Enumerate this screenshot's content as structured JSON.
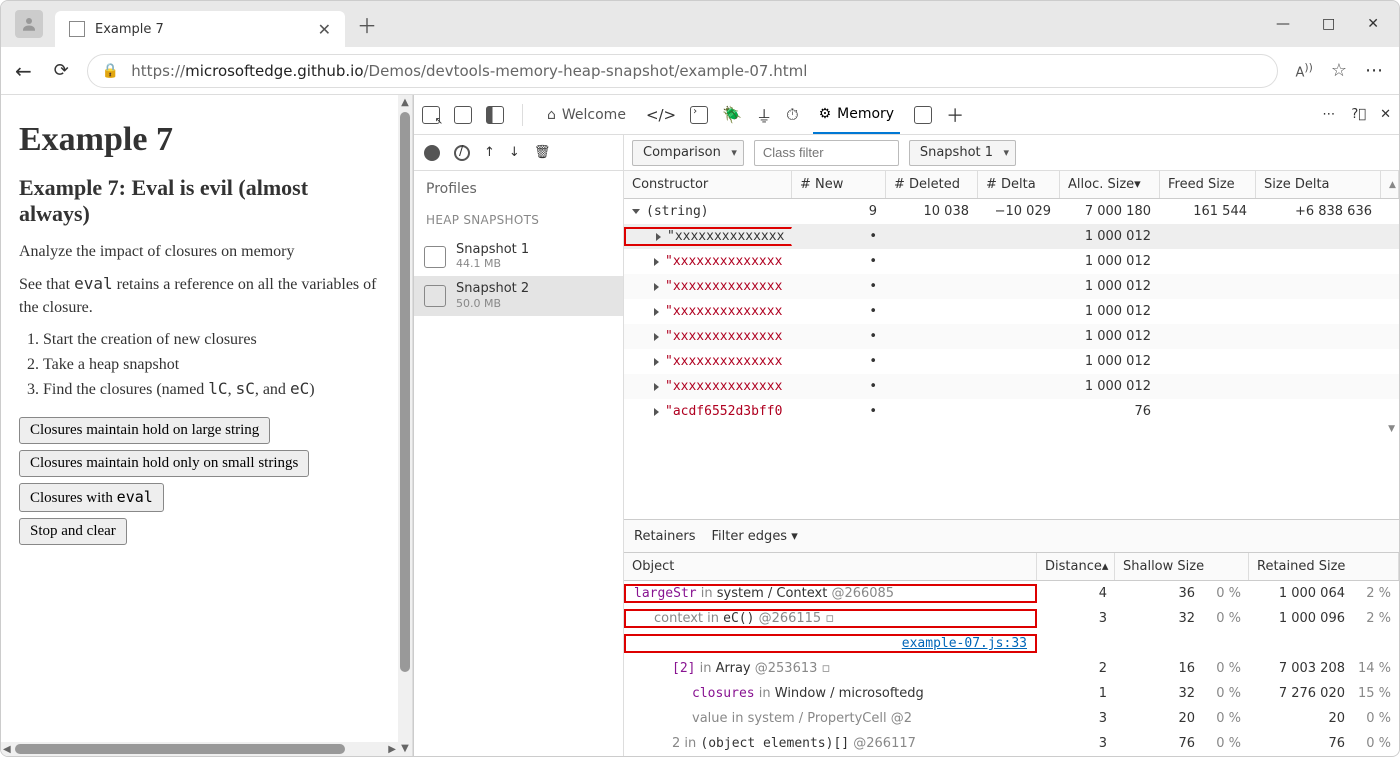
{
  "browser": {
    "tab_title": "Example 7",
    "url_prefix": "https://",
    "url_domain": "microsoftedge.github.io",
    "url_path": "/Demos/devtools-memory-heap-snapshot/example-07.html"
  },
  "page": {
    "h1": "Example 7",
    "h2": "Example 7: Eval is evil (almost always)",
    "p1": "Analyze the impact of closures on memory",
    "p2_pre": "See that ",
    "p2_code": "eval",
    "p2_post": " retains a reference on all the variables of the closure.",
    "steps": [
      "Start the creation of new closures",
      "Take a heap snapshot",
      "Find the closures (named lC, sC, and eC)"
    ],
    "btn1": "Closures maintain hold on large string",
    "btn2": "Closures maintain hold only on small strings",
    "btn3_pre": "Closures with ",
    "btn3_code": "eval",
    "btn4": "Stop and clear"
  },
  "devtools": {
    "tabs": {
      "welcome": "Welcome",
      "memory": "Memory"
    },
    "profiles": {
      "title": "Profiles",
      "section": "HEAP SNAPSHOTS",
      "snapshots": [
        {
          "name": "Snapshot 1",
          "size": "44.1 MB"
        },
        {
          "name": "Snapshot 2",
          "size": "50.0 MB"
        }
      ]
    },
    "toolbar": {
      "mode": "Comparison",
      "filter_placeholder": "Class filter",
      "base": "Snapshot 1"
    },
    "grid": {
      "headers": {
        "constructor": "Constructor",
        "new": "# New",
        "deleted": "# Deleted",
        "delta": "# Delta",
        "alloc": "Alloc. Size",
        "freed": "Freed Size",
        "size_delta": "Size Delta"
      },
      "rows": [
        {
          "expanded": true,
          "label": "(string)",
          "new": "9",
          "deleted": "10 038",
          "delta": "−10 029",
          "alloc": "7 000 180",
          "freed": "161 544",
          "size_delta": "+6 838 636"
        },
        {
          "indent": 1,
          "label": "\"xxxxxxxxxxxxxx",
          "dot": true,
          "alloc": "1 000 012",
          "highlight": true,
          "selected": true
        },
        {
          "indent": 1,
          "red": true,
          "label": "\"xxxxxxxxxxxxxx",
          "dot": true,
          "alloc": "1 000 012"
        },
        {
          "indent": 1,
          "red": true,
          "label": "\"xxxxxxxxxxxxxx",
          "dot": true,
          "alloc": "1 000 012"
        },
        {
          "indent": 1,
          "red": true,
          "label": "\"xxxxxxxxxxxxxx",
          "dot": true,
          "alloc": "1 000 012"
        },
        {
          "indent": 1,
          "red": true,
          "label": "\"xxxxxxxxxxxxxx",
          "dot": true,
          "alloc": "1 000 012"
        },
        {
          "indent": 1,
          "red": true,
          "label": "\"xxxxxxxxxxxxxx",
          "dot": true,
          "alloc": "1 000 012"
        },
        {
          "indent": 1,
          "red": true,
          "label": "\"xxxxxxxxxxxxxx",
          "dot": true,
          "alloc": "1 000 012"
        },
        {
          "indent": 1,
          "red": true,
          "label": "\"acdf6552d3bff0",
          "dot": true,
          "alloc": "76"
        }
      ]
    },
    "retainers": {
      "title": "Retainers",
      "filter": "Filter edges",
      "headers": {
        "object": "Object",
        "distance": "Distance",
        "shallow": "Shallow Size",
        "retained": "Retained Size"
      },
      "rows": [
        {
          "depth": 0,
          "expanded": true,
          "highlight": true,
          "parts": [
            {
              "t": "largeStr",
              "c": "purple mono"
            },
            {
              "t": " in ",
              "c": "gray"
            },
            {
              "t": "system / Context ",
              "c": ""
            },
            {
              "t": "@266085",
              "c": "gray"
            }
          ],
          "distance": "4",
          "shallow": "36",
          "shallow_pct": "0 %",
          "retained": "1 000 064",
          "retained_pct": "2 %"
        },
        {
          "depth": 1,
          "expanded": true,
          "highlight": true,
          "parts": [
            {
              "t": "context",
              "c": "gray"
            },
            {
              "t": " in ",
              "c": "gray"
            },
            {
              "t": "eC()",
              "c": "mono"
            },
            {
              "t": " @266115",
              "c": "gray"
            },
            {
              "t": " ▫",
              "c": "gray"
            }
          ],
          "distance": "3",
          "shallow": "32",
          "shallow_pct": "0 %",
          "retained": "1 000 096",
          "retained_pct": "2 %"
        },
        {
          "depth": 1,
          "link": "example-07.js:33",
          "highlight": true
        },
        {
          "depth": 2,
          "expanded": true,
          "parts": [
            {
              "t": "[2]",
              "c": "purple mono"
            },
            {
              "t": " in ",
              "c": "gray"
            },
            {
              "t": "Array ",
              "c": ""
            },
            {
              "t": "@253613",
              "c": "gray"
            },
            {
              "t": " ▫",
              "c": "gray"
            }
          ],
          "distance": "2",
          "shallow": "16",
          "shallow_pct": "0 %",
          "retained": "7 003 208",
          "retained_pct": "14 %"
        },
        {
          "depth": 3,
          "parts": [
            {
              "t": "closures",
              "c": "purple mono"
            },
            {
              "t": " in ",
              "c": "gray"
            },
            {
              "t": "Window / microsoftedg",
              "c": ""
            }
          ],
          "distance": "1",
          "shallow": "32",
          "shallow_pct": "0 %",
          "retained": "7 276 020",
          "retained_pct": "15 %"
        },
        {
          "depth": 3,
          "parts": [
            {
              "t": "value",
              "c": "gray"
            },
            {
              "t": " in ",
              "c": "gray"
            },
            {
              "t": "system / PropertyCell @2",
              "c": "gray"
            }
          ],
          "distance": "3",
          "shallow": "20",
          "shallow_pct": "0 %",
          "retained": "20",
          "retained_pct": "0 %"
        },
        {
          "depth": 2,
          "parts": [
            {
              "t": "2",
              "c": "gray"
            },
            {
              "t": " in ",
              "c": "gray"
            },
            {
              "t": "(object elements)[]",
              "c": "mono"
            },
            {
              "t": " @266117",
              "c": "gray"
            }
          ],
          "distance": "3",
          "shallow": "76",
          "shallow_pct": "0 %",
          "retained": "76",
          "retained_pct": "0 %"
        }
      ]
    }
  }
}
